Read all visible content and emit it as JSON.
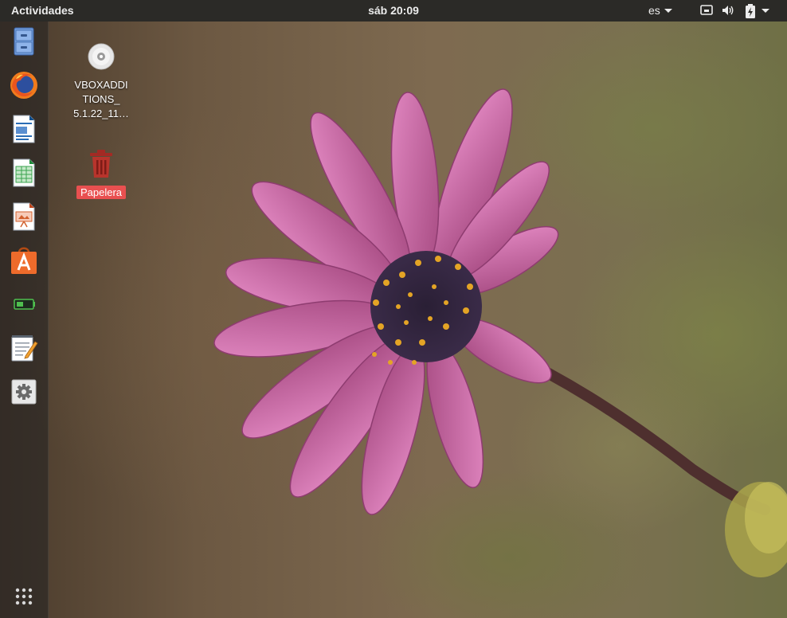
{
  "topbar": {
    "activities": "Actividades",
    "clock": "sáb 20:09",
    "language": "es",
    "icons": [
      "network-icon",
      "volume-icon",
      "battery-icon",
      "system-menu-arrow-icon"
    ]
  },
  "dock": {
    "items": [
      {
        "name": "files",
        "icon": "file-cabinet-icon"
      },
      {
        "name": "firefox",
        "icon": "firefox-icon"
      },
      {
        "name": "libreoffice-writer",
        "icon": "writer-document-icon"
      },
      {
        "name": "libreoffice-calc",
        "icon": "calc-spreadsheet-icon"
      },
      {
        "name": "libreoffice-impress",
        "icon": "impress-presentation-icon"
      },
      {
        "name": "software-center",
        "icon": "shopping-bag-icon"
      },
      {
        "name": "virtualbox",
        "icon": "battery-terminal-icon"
      },
      {
        "name": "text-editor",
        "icon": "notepad-pencil-icon"
      },
      {
        "name": "settings",
        "icon": "gear-icon"
      }
    ],
    "show_apps_icon": "grid-dots-icon"
  },
  "desktop": {
    "icons": [
      {
        "label_line1": "VBOXADDI",
        "label_line2": "TIONS_",
        "label_line3": "5.1.22_11…",
        "icon": "cd-disc-icon"
      },
      {
        "label": "Papelera",
        "icon": "trash-icon",
        "selected": true
      }
    ]
  },
  "colors": {
    "topbar_bg": "#2b2a27",
    "selection_red": "#e95050",
    "petal_pink": "#c868a8"
  }
}
